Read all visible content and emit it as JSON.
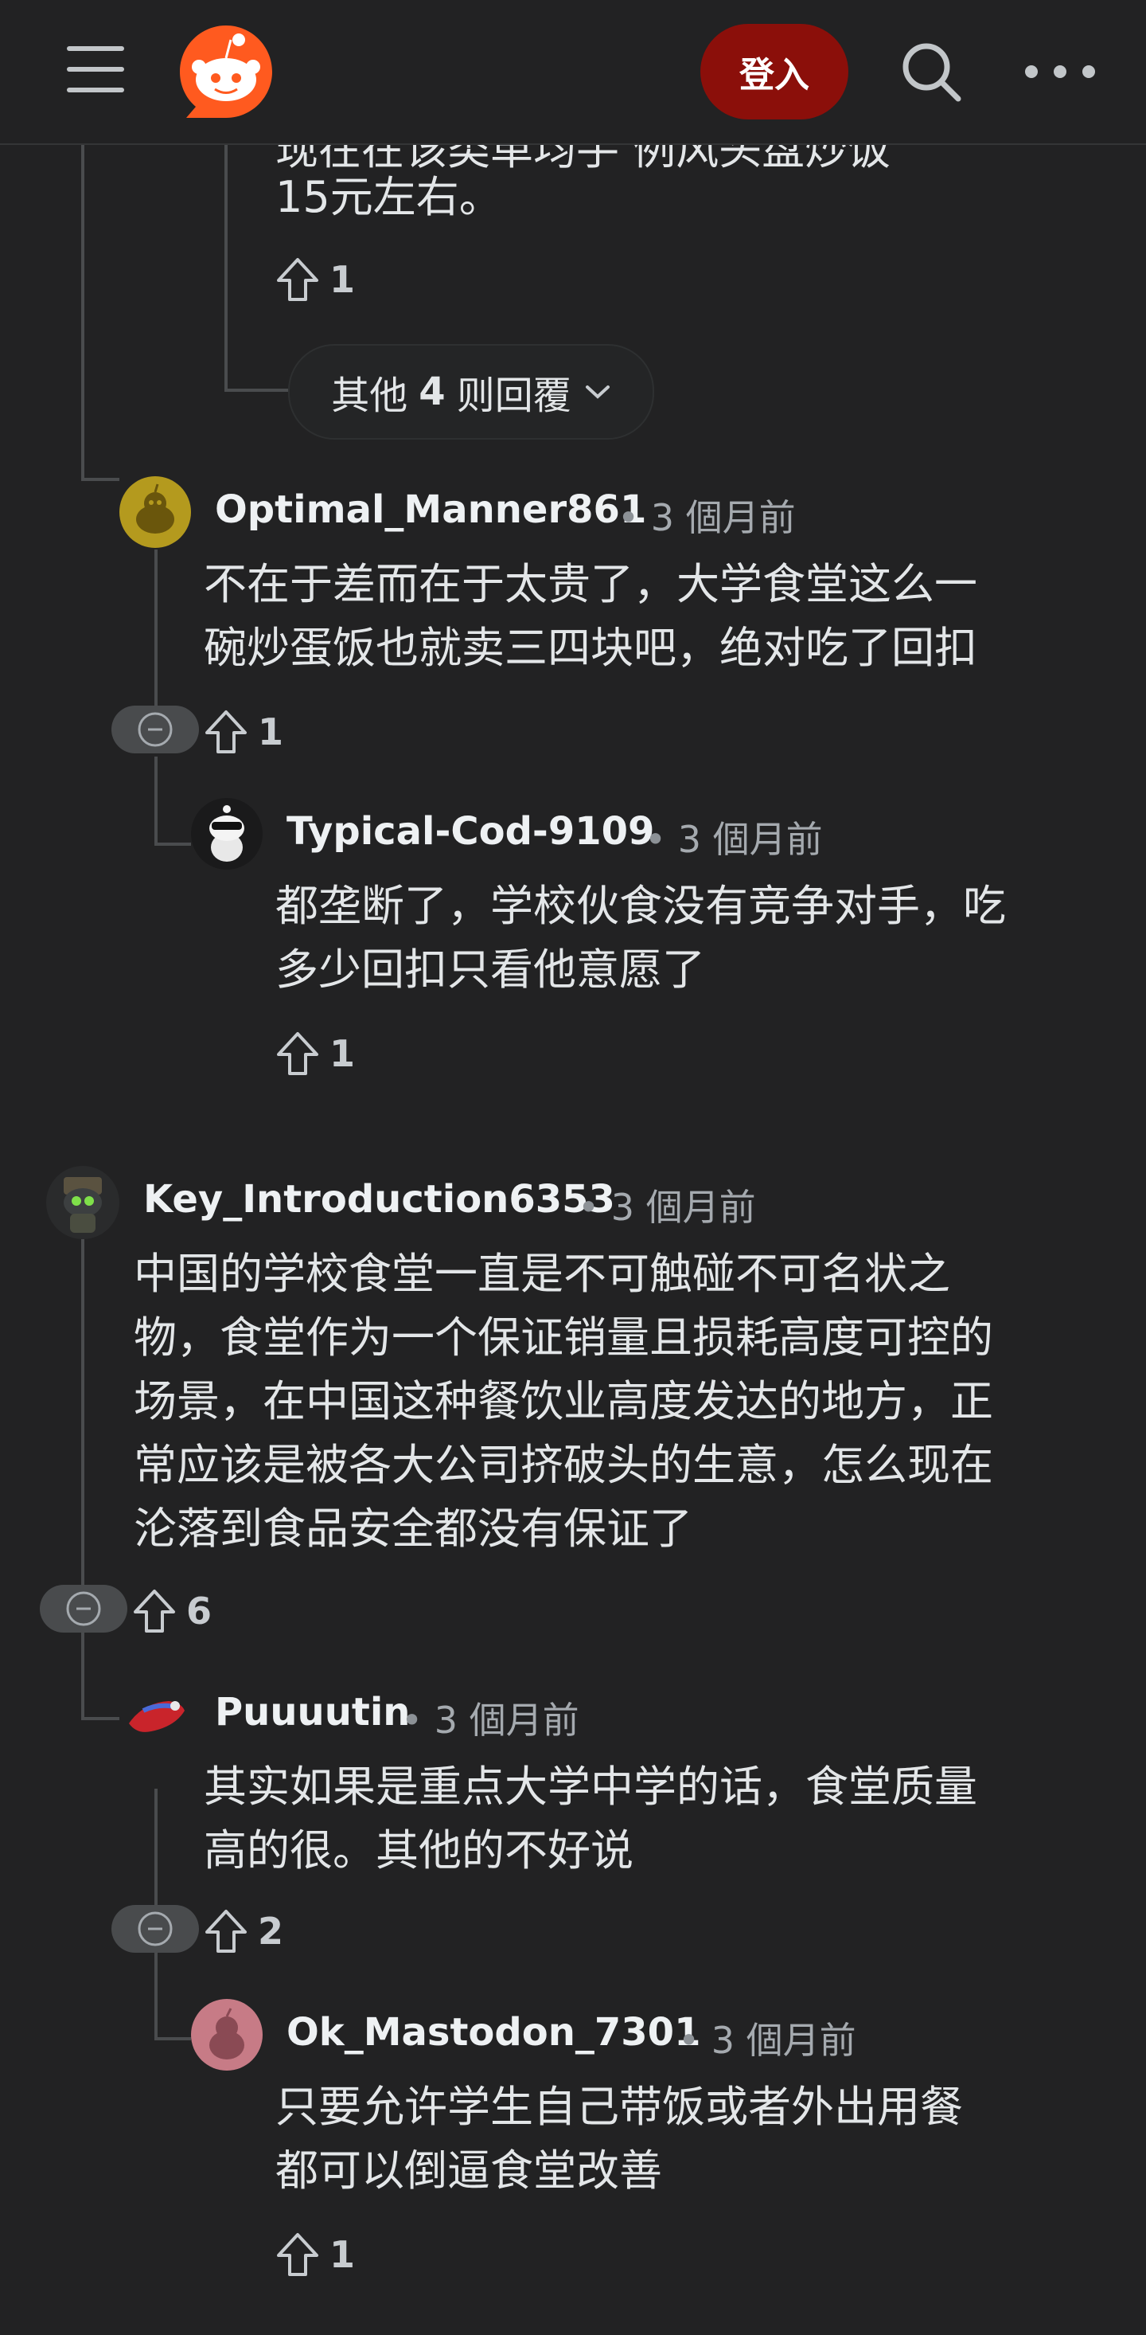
{
  "header": {
    "menu_icon": "hamburger-menu-icon",
    "logo_icon": "reddit-logo-icon",
    "login_label": "登入",
    "search_icon": "search-icon",
    "more_icon": "more-options-icon"
  },
  "colors": {
    "background": "#222223",
    "login_bg": "#8b0f0a",
    "thread_line": "#4a4c4e",
    "text": "#e3e6e8",
    "meta": "#a5aaaf"
  },
  "partial_comment": {
    "text_cut": "现在在该类单均手            例风头盘炒饭",
    "text_line2": "15元左右。",
    "votes": "1"
  },
  "more_replies": {
    "prefix": "其他",
    "count": "4",
    "suffix": "则回覆"
  },
  "comments": [
    {
      "username": "Optimal_Manner861",
      "time": "3 個月前",
      "lines": [
        "不在于差而在于太贵了，大学食堂这么一",
        "碗炒蛋饭也就卖三四块吧，绝对吃了回扣"
      ],
      "votes": "1"
    },
    {
      "username": "Typical-Cod-9109",
      "time": "3 個月前",
      "lines": [
        "都垄断了，学校伙食没有竞争对手，吃",
        "多少回扣只看他意愿了"
      ],
      "votes": "1"
    },
    {
      "username": "Key_Introduction6353",
      "time": "3 個月前",
      "lines": [
        "中国的学校食堂一直是不可触碰不可名状之",
        "物，食堂作为一个保证销量且损耗高度可控的",
        "场景，在中国这种餐饮业高度发达的地方，正",
        "常应该是被各大公司挤破头的生意，怎么现在",
        "沦落到食品安全都没有保证了"
      ],
      "votes": "6"
    },
    {
      "username": "Puuuutin",
      "time": "3 個月前",
      "lines": [
        "其实如果是重点大学中学的话，食堂质量",
        "高的很。其他的不好说"
      ],
      "votes": "2"
    },
    {
      "username": "Ok_Mastodon_7301",
      "time": "3 個月前",
      "lines": [
        "只要允许学生自己带饭或者外出用餐",
        "都可以倒逼食堂改善"
      ],
      "votes": "1"
    }
  ]
}
